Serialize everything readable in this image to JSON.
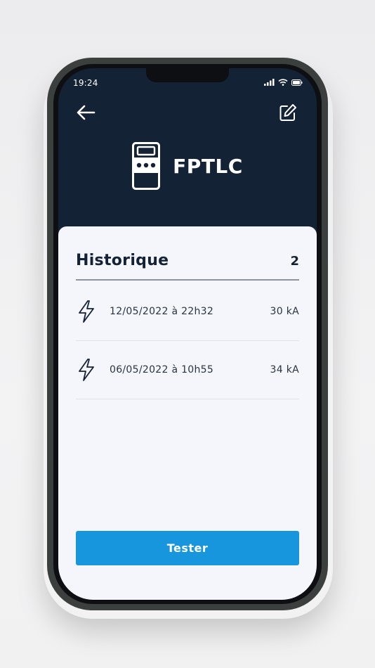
{
  "status_bar": {
    "time": "19:24"
  },
  "header": {
    "device_name": "FPTLC",
    "back_icon": "arrow-left-icon",
    "edit_icon": "edit-icon",
    "device_icon": "meter-device-icon"
  },
  "history": {
    "title": "Historique",
    "count": "2",
    "items": [
      {
        "date": "12/05/2022 à 22h32",
        "value": "30 kA",
        "icon": "lightning-icon"
      },
      {
        "date": "06/05/2022 à 10h55",
        "value": "34 kA",
        "icon": "lightning-icon"
      }
    ]
  },
  "actions": {
    "tester_label": "Tester"
  },
  "colors": {
    "header_bg": "#142235",
    "card_bg": "#f4f6fc",
    "accent": "#1796dd"
  }
}
